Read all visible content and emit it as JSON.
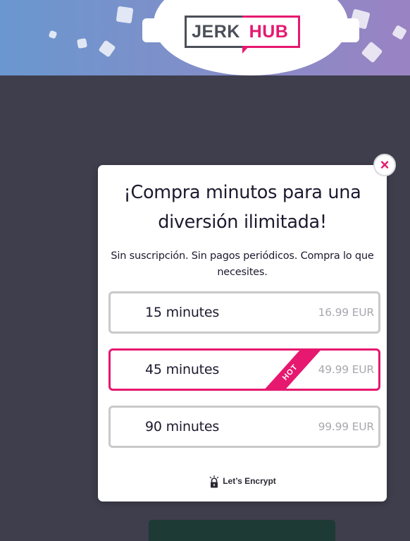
{
  "brand": {
    "logo_part1": "JERK",
    "logo_part2": "HUB",
    "accent_color": "#e6186f",
    "header_gradient": [
      "#6a97cf",
      "#9a83c3"
    ]
  },
  "modal": {
    "close_icon": "close-icon",
    "title_line1": "¡Compra minutos para una",
    "title_line2": "diversión ilimitada!",
    "subtitle_line1": "Sin suscripción. Sin pagos periódicos. Compra lo que",
    "subtitle_line2": "necesites.",
    "options": [
      {
        "label": "15 minutes",
        "price": "16.99 EUR",
        "hot": false
      },
      {
        "label": "45 minutes",
        "price": "49.99 EUR",
        "hot": true,
        "badge": "HOT"
      },
      {
        "label": "90 minutes",
        "price": "99.99 EUR",
        "hot": false
      }
    ],
    "security_label": "Let’s Encrypt",
    "security_icon": "lock-icon"
  }
}
